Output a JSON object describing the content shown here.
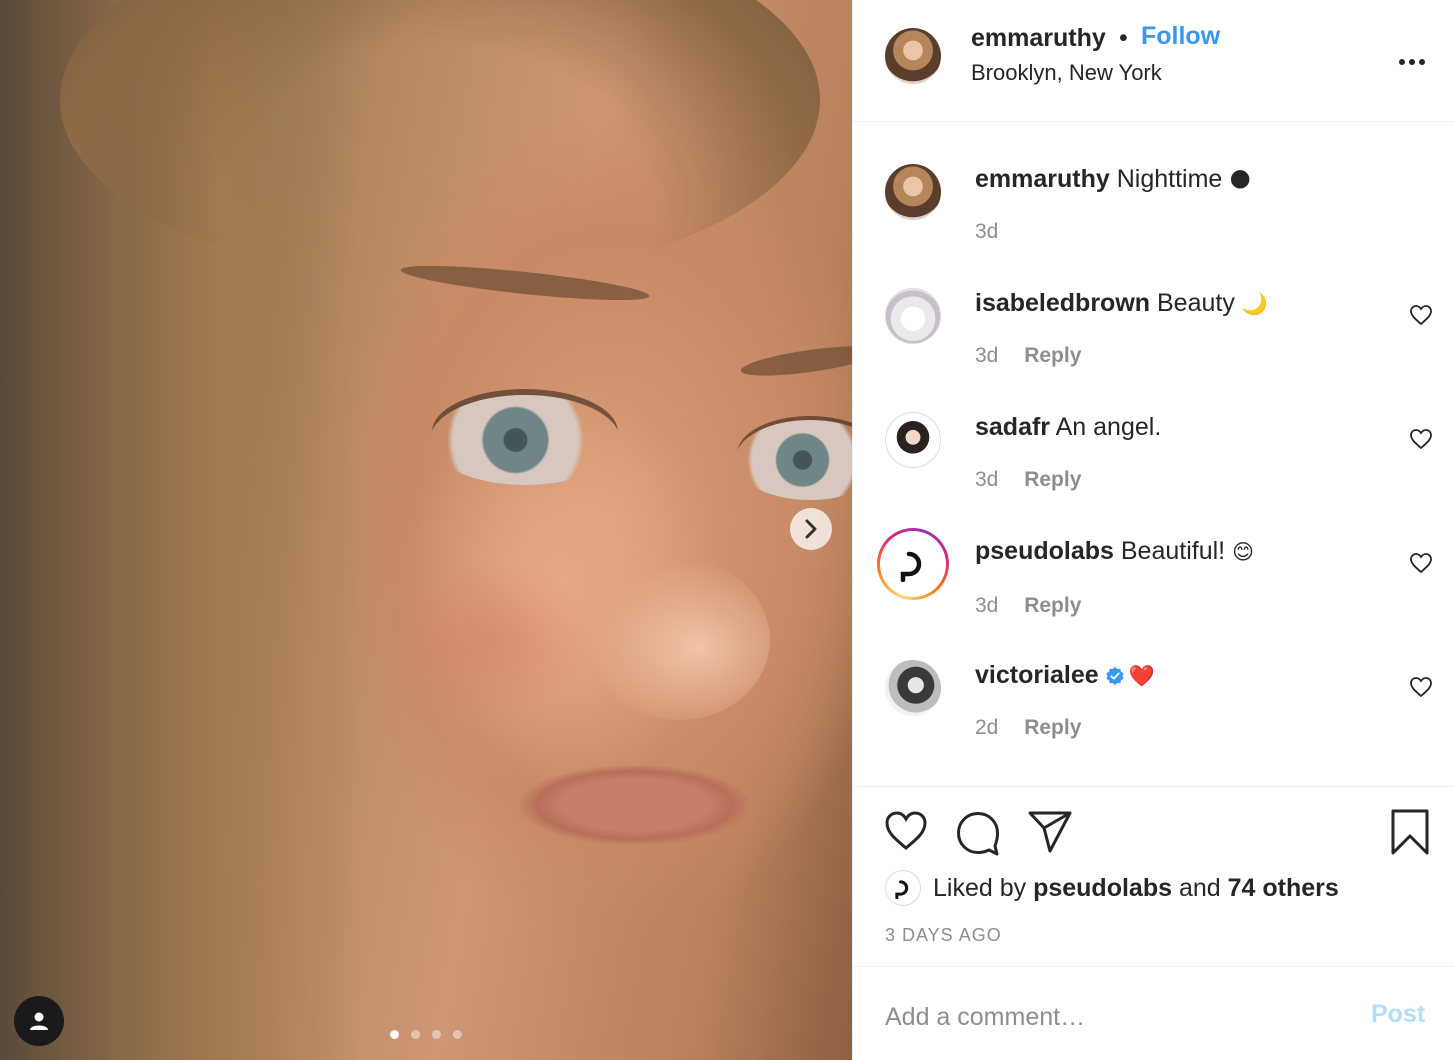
{
  "post": {
    "owner": "emmaruthy",
    "separator": "•",
    "follow_label": "Follow",
    "location": "Brooklyn, New York",
    "more_label": "•••"
  },
  "caption": {
    "username": "emmaruthy",
    "text": "Nighttime",
    "emoji": "🌑",
    "time": "3d"
  },
  "comments": [
    {
      "username": "isabeledbrown",
      "text": "Beauty",
      "emoji": "🌙",
      "time": "3d",
      "reply_label": "Reply"
    },
    {
      "username": "sadafr",
      "text": "An angel.",
      "emoji": "",
      "time": "3d",
      "reply_label": "Reply"
    },
    {
      "username": "pseudolabs",
      "text": "Beautiful!",
      "emoji": "😊",
      "time": "3d",
      "reply_label": "Reply"
    },
    {
      "username": "victorialee",
      "text": "",
      "emoji": "❤️",
      "verified": true,
      "time": "2d",
      "reply_label": "Reply"
    }
  ],
  "likes": {
    "prefix": "Liked by",
    "user": "pseudolabs",
    "joiner": "and",
    "others": "74 others"
  },
  "timestamp": "3 DAYS AGO",
  "comment_box": {
    "placeholder": "Add a comment…",
    "post_label": "Post"
  },
  "carousel": {
    "count": 4,
    "active_index": 0
  },
  "colors": {
    "accent": "#3897f0",
    "post_disabled": "#b2dffc",
    "muted_text": "#8e8e8e",
    "text": "#262626",
    "divider": "#efefef"
  },
  "icons": {
    "next": "chevron-right-icon",
    "user_tag": "person-icon",
    "like": "heart-icon",
    "comment": "comment-bubble-icon",
    "share": "paper-plane-icon",
    "save": "bookmark-icon",
    "more": "more-horizontal-icon",
    "verified": "verified-badge-icon"
  }
}
